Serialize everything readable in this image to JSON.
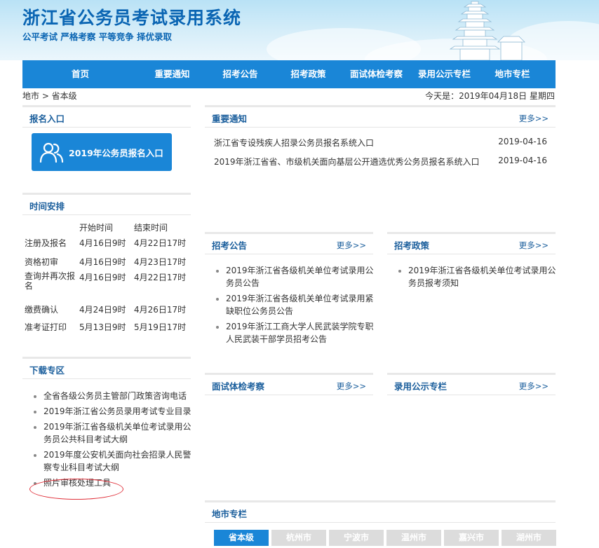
{
  "header": {
    "title": "浙江省公务员考试录用系统",
    "slogan": "公平考试 严格考察 平等竞争 择优录取"
  },
  "nav": [
    "首页",
    "重要通知",
    "招考公告",
    "招考政策",
    "面试体检考察",
    "录用公示专栏",
    "地市专栏"
  ],
  "breadcrumb": "地市 > 省本级",
  "today": "今天是：2019年04月18日 星期四",
  "more_label": "更多>>",
  "registration": {
    "title": "报名入口",
    "button_label": "2019年公务员报名入口"
  },
  "schedule": {
    "title": "时间安排",
    "headers": [
      "",
      "开始时间",
      "结束时间"
    ],
    "rows": [
      [
        "注册及报名",
        "4月16日9时",
        "4月22日17时"
      ],
      [
        "资格初审",
        "4月16日9时",
        "4月23日17时"
      ],
      [
        "查询并再次报名",
        "4月16日9时",
        "4月22日17时"
      ],
      [
        "缴费确认",
        "4月24日9时",
        "4月26日17时"
      ],
      [
        "准考证打印",
        "5月13日9时",
        "5月19日17时"
      ]
    ]
  },
  "downloads": {
    "title": "下载专区",
    "items": [
      "全省各级公务员主管部门政策咨询电话",
      "2019年浙江省公务员录用考试专业目录",
      "2019年浙江省各级机关单位考试录用公务员公共科目考试大纲",
      "2019年度公安机关面向社会招录人民警察专业科目考试大纲",
      "照片审核处理工具"
    ]
  },
  "important": {
    "title": "重要通知",
    "items": [
      {
        "text": "浙江省专设残疾人招录公务员报名系统入口",
        "date": "2019-04-16"
      },
      {
        "text": "2019年浙江省省、市级机关面向基层公开遴选优秀公务员报名系统入口",
        "date": "2019-04-16"
      }
    ]
  },
  "recruit_notice": {
    "title": "招考公告",
    "items": [
      "2019年浙江省各级机关单位考试录用公务员公告",
      "2019年浙江省各级机关单位考试录用紧缺职位公务员公告",
      "2019年浙江工商大学人民武装学院专职人民武装干部学员招考公告"
    ]
  },
  "recruit_policy": {
    "title": "招考政策",
    "items": [
      "2019年浙江省各级机关单位考试录用公务员报考须知"
    ]
  },
  "interview": {
    "title": "面试体检考察"
  },
  "publicity": {
    "title": "录用公示专栏"
  },
  "city": {
    "title": "地市专栏",
    "tabs": [
      "省本级",
      "杭州市",
      "宁波市",
      "温州市",
      "嘉兴市",
      "湖州市"
    ]
  }
}
